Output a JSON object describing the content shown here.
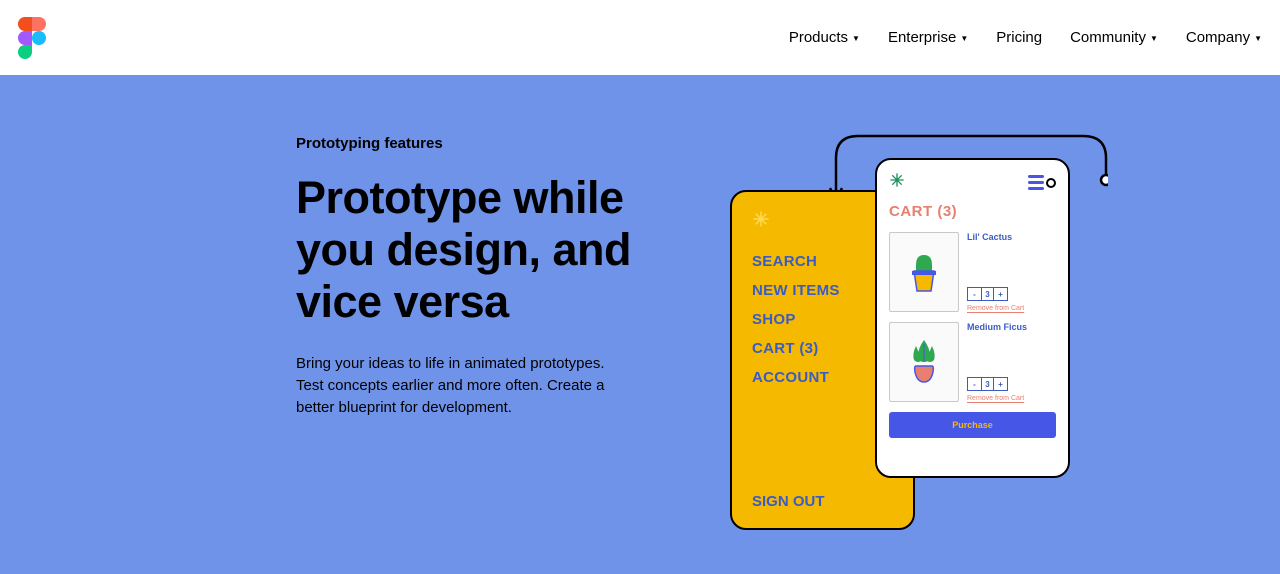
{
  "nav": {
    "items": [
      {
        "label": "Products",
        "dropdown": true
      },
      {
        "label": "Enterprise",
        "dropdown": true
      },
      {
        "label": "Pricing",
        "dropdown": false
      },
      {
        "label": "Community",
        "dropdown": true
      },
      {
        "label": "Company",
        "dropdown": true
      }
    ]
  },
  "hero": {
    "eyebrow": "Prototyping features",
    "headline": "Prototype while you design, and vice versa",
    "body": "Bring your ideas to life in animated prototypes. Test concepts earlier and more often. Create a better blueprint for development."
  },
  "mock": {
    "back_menu": [
      "SEARCH",
      "NEW ITEMS",
      "SHOP",
      "CART (3)",
      "ACCOUNT"
    ],
    "back_signout": "SIGN OUT",
    "front": {
      "title": "CART (3)",
      "items": [
        {
          "name": "Lil' Cactus",
          "qty": "3",
          "remove": "Remove from Cart"
        },
        {
          "name": "Medium Ficus",
          "qty": "3",
          "remove": "Remove from Cart"
        }
      ],
      "purchase": "Purchase"
    }
  }
}
